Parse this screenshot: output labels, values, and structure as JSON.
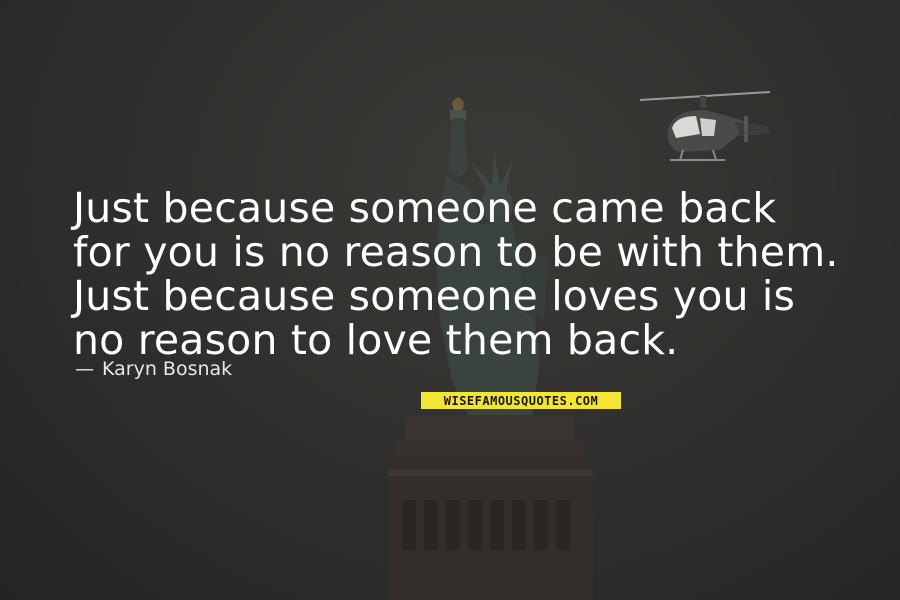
{
  "quote": {
    "lines": [
      "Just because someone came back",
      "for you is no reason to be with them.",
      "Just because someone loves you is",
      "no reason to love them back."
    ]
  },
  "author": {
    "dash": "—",
    "name": "Karyn Bosnak"
  },
  "brand": {
    "text": "WISEFAMOUSQUOTES.COM",
    "color": "#f2e533"
  },
  "background": {
    "subjects": [
      "statue-of-liberty",
      "helicopter"
    ],
    "sky_color": "#2f2e2c"
  }
}
